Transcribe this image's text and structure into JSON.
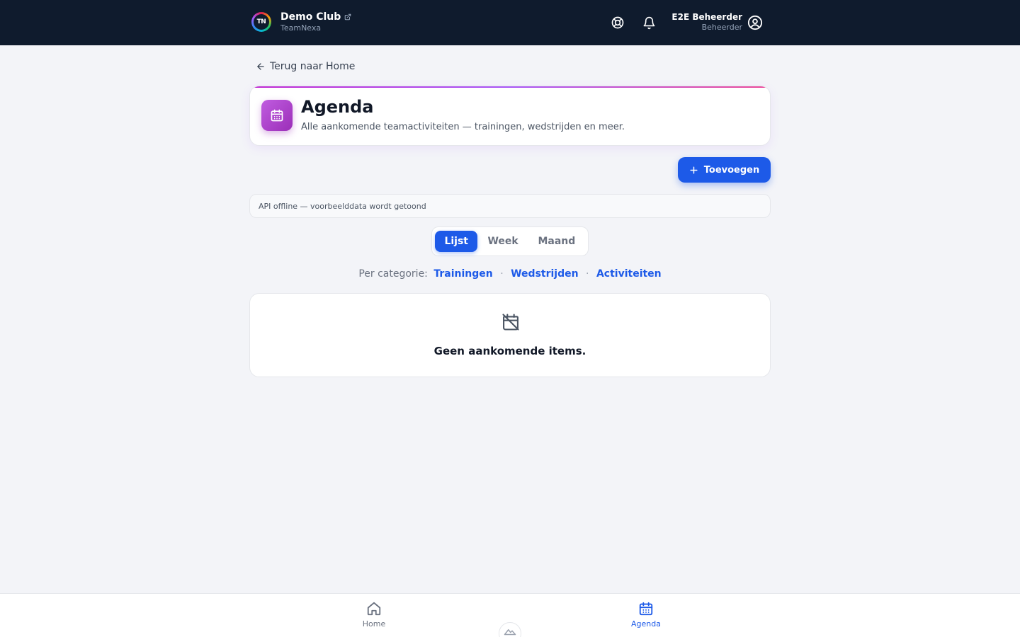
{
  "topbar": {
    "club_name": "Demo Club",
    "club_sub": "TeamNexa",
    "logo_text": "TN",
    "user_name": "E2E Beheerder",
    "user_role": "Beheerder"
  },
  "back_link": "Terug naar Home",
  "header": {
    "title": "Agenda",
    "subtitle": "Alle aankomende teamactiviteiten — trainingen, wedstrijden en meer."
  },
  "add_button": "Toevoegen",
  "notice": "API offline — voorbeelddata wordt getoond",
  "view_tabs": {
    "list": "Lijst",
    "week": "Week",
    "month": "Maand",
    "active": "Lijst"
  },
  "categories": {
    "label": "Per categorie:",
    "separator": "·",
    "items": [
      "Trainingen",
      "Wedstrijden",
      "Activiteiten"
    ]
  },
  "empty_state": "Geen aankomende items.",
  "bottom_nav": {
    "home": "Home",
    "agenda": "Agenda",
    "active": "Agenda"
  },
  "colors": {
    "topbar_bg": "#0f1b2d",
    "accent_blue": "#1d5ae8",
    "agenda_purple": "#a855f7",
    "page_bg": "#f3f4f8"
  },
  "icons": [
    "external-link-icon",
    "help-icon",
    "bell-icon",
    "user-icon",
    "arrow-left-icon",
    "calendar-icon",
    "plus-icon",
    "calendar-off-icon",
    "home-icon",
    "mountain-icon"
  ]
}
